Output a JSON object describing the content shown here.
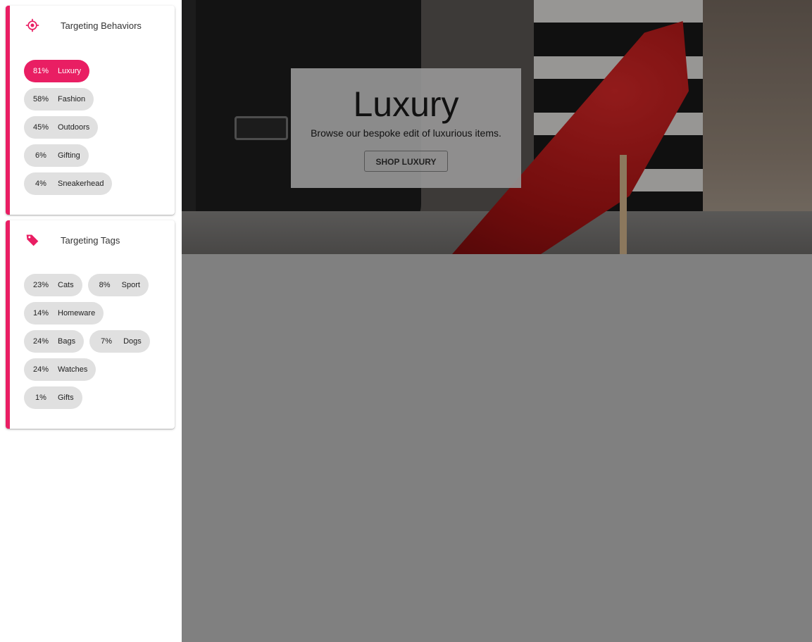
{
  "colors": {
    "accent": "#e91e63",
    "chip_bg": "#e0e0e0",
    "main_bg": "#808080"
  },
  "behaviors": {
    "title": "Targeting Behaviors",
    "icon": "target-icon",
    "chips": [
      {
        "pct": "81%",
        "label": "Luxury",
        "active": true
      },
      {
        "pct": "58%",
        "label": "Fashion"
      },
      {
        "pct": "45%",
        "label": "Outdoors"
      },
      {
        "pct": "6%",
        "label": "Gifting"
      },
      {
        "pct": "4%",
        "label": "Sneakerhead"
      }
    ]
  },
  "tags": {
    "title": "Targeting Tags",
    "icon": "tag-icon",
    "chips": [
      {
        "pct": "23%",
        "label": "Cats"
      },
      {
        "pct": "8%",
        "label": "Sport"
      },
      {
        "pct": "14%",
        "label": "Homeware"
      },
      {
        "pct": "24%",
        "label": "Bags"
      },
      {
        "pct": "7%",
        "label": "Dogs"
      },
      {
        "pct": "24%",
        "label": "Watches"
      },
      {
        "pct": "1%",
        "label": "Gifts"
      }
    ]
  },
  "hero": {
    "title": "Luxury",
    "subtitle": "Browse our bespoke edit of luxurious items.",
    "button": "SHOP LUXURY"
  }
}
